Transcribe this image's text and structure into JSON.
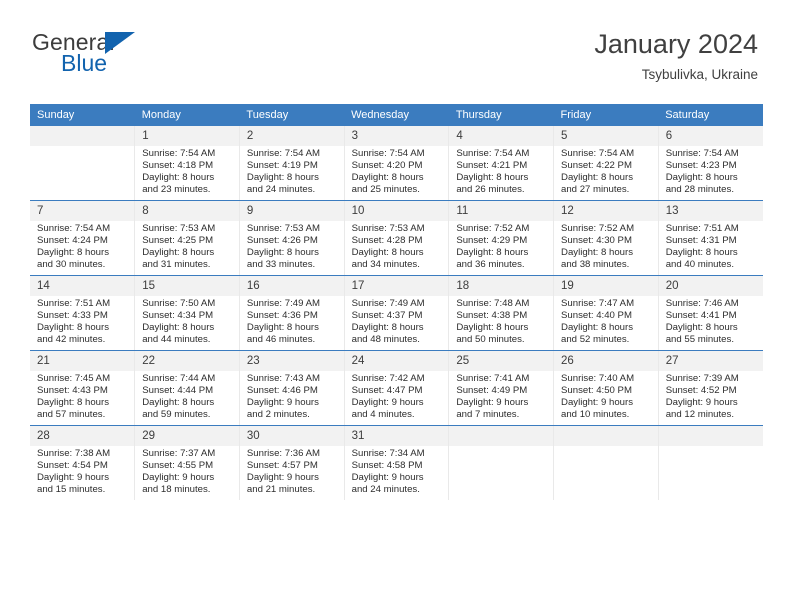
{
  "brand": {
    "word1": "General",
    "word2": "Blue",
    "triangle_icon": "triangle-icon",
    "accent_color": "#1263ae"
  },
  "header": {
    "title": "January 2024",
    "subtitle": "Tsybulivka, Ukraine",
    "header_bg_color": "#3b7cbf"
  },
  "calendar": {
    "weekday_headers": [
      "Sunday",
      "Monday",
      "Tuesday",
      "Wednesday",
      "Thursday",
      "Friday",
      "Saturday"
    ],
    "weeks": [
      [
        {
          "day": "",
          "lines": []
        },
        {
          "day": "1",
          "lines": [
            "Sunrise: 7:54 AM",
            "Sunset: 4:18 PM",
            "Daylight: 8 hours",
            "and 23 minutes."
          ]
        },
        {
          "day": "2",
          "lines": [
            "Sunrise: 7:54 AM",
            "Sunset: 4:19 PM",
            "Daylight: 8 hours",
            "and 24 minutes."
          ]
        },
        {
          "day": "3",
          "lines": [
            "Sunrise: 7:54 AM",
            "Sunset: 4:20 PM",
            "Daylight: 8 hours",
            "and 25 minutes."
          ]
        },
        {
          "day": "4",
          "lines": [
            "Sunrise: 7:54 AM",
            "Sunset: 4:21 PM",
            "Daylight: 8 hours",
            "and 26 minutes."
          ]
        },
        {
          "day": "5",
          "lines": [
            "Sunrise: 7:54 AM",
            "Sunset: 4:22 PM",
            "Daylight: 8 hours",
            "and 27 minutes."
          ]
        },
        {
          "day": "6",
          "lines": [
            "Sunrise: 7:54 AM",
            "Sunset: 4:23 PM",
            "Daylight: 8 hours",
            "and 28 minutes."
          ]
        }
      ],
      [
        {
          "day": "7",
          "lines": [
            "Sunrise: 7:54 AM",
            "Sunset: 4:24 PM",
            "Daylight: 8 hours",
            "and 30 minutes."
          ]
        },
        {
          "day": "8",
          "lines": [
            "Sunrise: 7:53 AM",
            "Sunset: 4:25 PM",
            "Daylight: 8 hours",
            "and 31 minutes."
          ]
        },
        {
          "day": "9",
          "lines": [
            "Sunrise: 7:53 AM",
            "Sunset: 4:26 PM",
            "Daylight: 8 hours",
            "and 33 minutes."
          ]
        },
        {
          "day": "10",
          "lines": [
            "Sunrise: 7:53 AM",
            "Sunset: 4:28 PM",
            "Daylight: 8 hours",
            "and 34 minutes."
          ]
        },
        {
          "day": "11",
          "lines": [
            "Sunrise: 7:52 AM",
            "Sunset: 4:29 PM",
            "Daylight: 8 hours",
            "and 36 minutes."
          ]
        },
        {
          "day": "12",
          "lines": [
            "Sunrise: 7:52 AM",
            "Sunset: 4:30 PM",
            "Daylight: 8 hours",
            "and 38 minutes."
          ]
        },
        {
          "day": "13",
          "lines": [
            "Sunrise: 7:51 AM",
            "Sunset: 4:31 PM",
            "Daylight: 8 hours",
            "and 40 minutes."
          ]
        }
      ],
      [
        {
          "day": "14",
          "lines": [
            "Sunrise: 7:51 AM",
            "Sunset: 4:33 PM",
            "Daylight: 8 hours",
            "and 42 minutes."
          ]
        },
        {
          "day": "15",
          "lines": [
            "Sunrise: 7:50 AM",
            "Sunset: 4:34 PM",
            "Daylight: 8 hours",
            "and 44 minutes."
          ]
        },
        {
          "day": "16",
          "lines": [
            "Sunrise: 7:49 AM",
            "Sunset: 4:36 PM",
            "Daylight: 8 hours",
            "and 46 minutes."
          ]
        },
        {
          "day": "17",
          "lines": [
            "Sunrise: 7:49 AM",
            "Sunset: 4:37 PM",
            "Daylight: 8 hours",
            "and 48 minutes."
          ]
        },
        {
          "day": "18",
          "lines": [
            "Sunrise: 7:48 AM",
            "Sunset: 4:38 PM",
            "Daylight: 8 hours",
            "and 50 minutes."
          ]
        },
        {
          "day": "19",
          "lines": [
            "Sunrise: 7:47 AM",
            "Sunset: 4:40 PM",
            "Daylight: 8 hours",
            "and 52 minutes."
          ]
        },
        {
          "day": "20",
          "lines": [
            "Sunrise: 7:46 AM",
            "Sunset: 4:41 PM",
            "Daylight: 8 hours",
            "and 55 minutes."
          ]
        }
      ],
      [
        {
          "day": "21",
          "lines": [
            "Sunrise: 7:45 AM",
            "Sunset: 4:43 PM",
            "Daylight: 8 hours",
            "and 57 minutes."
          ]
        },
        {
          "day": "22",
          "lines": [
            "Sunrise: 7:44 AM",
            "Sunset: 4:44 PM",
            "Daylight: 8 hours",
            "and 59 minutes."
          ]
        },
        {
          "day": "23",
          "lines": [
            "Sunrise: 7:43 AM",
            "Sunset: 4:46 PM",
            "Daylight: 9 hours",
            "and 2 minutes."
          ]
        },
        {
          "day": "24",
          "lines": [
            "Sunrise: 7:42 AM",
            "Sunset: 4:47 PM",
            "Daylight: 9 hours",
            "and 4 minutes."
          ]
        },
        {
          "day": "25",
          "lines": [
            "Sunrise: 7:41 AM",
            "Sunset: 4:49 PM",
            "Daylight: 9 hours",
            "and 7 minutes."
          ]
        },
        {
          "day": "26",
          "lines": [
            "Sunrise: 7:40 AM",
            "Sunset: 4:50 PM",
            "Daylight: 9 hours",
            "and 10 minutes."
          ]
        },
        {
          "day": "27",
          "lines": [
            "Sunrise: 7:39 AM",
            "Sunset: 4:52 PM",
            "Daylight: 9 hours",
            "and 12 minutes."
          ]
        }
      ],
      [
        {
          "day": "28",
          "lines": [
            "Sunrise: 7:38 AM",
            "Sunset: 4:54 PM",
            "Daylight: 9 hours",
            "and 15 minutes."
          ]
        },
        {
          "day": "29",
          "lines": [
            "Sunrise: 7:37 AM",
            "Sunset: 4:55 PM",
            "Daylight: 9 hours",
            "and 18 minutes."
          ]
        },
        {
          "day": "30",
          "lines": [
            "Sunrise: 7:36 AM",
            "Sunset: 4:57 PM",
            "Daylight: 9 hours",
            "and 21 minutes."
          ]
        },
        {
          "day": "31",
          "lines": [
            "Sunrise: 7:34 AM",
            "Sunset: 4:58 PM",
            "Daylight: 9 hours",
            "and 24 minutes."
          ]
        },
        {
          "day": "",
          "lines": []
        },
        {
          "day": "",
          "lines": []
        },
        {
          "day": "",
          "lines": []
        }
      ]
    ]
  }
}
